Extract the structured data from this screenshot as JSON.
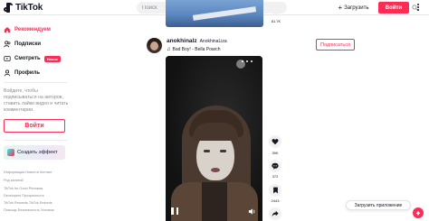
{
  "header": {
    "logo_text": "TikTok",
    "search_placeholder": "Поиск",
    "upload_label": "Загрузить",
    "login_label": "Войти"
  },
  "sidebar": {
    "items": [
      {
        "label": "Рекомендуем",
        "icon": "home-icon",
        "active": true
      },
      {
        "label": "Подписки",
        "icon": "users-icon"
      },
      {
        "label": "Смотреть",
        "icon": "live-icon",
        "badge": "Новое"
      },
      {
        "label": "Профиль",
        "icon": "user-icon"
      }
    ],
    "login_prompt": "Войдите, чтобы подписываться на авторов, ставить лайки видео и читать комментарии.",
    "login_button": "Войти",
    "effect_button": "Создать эффект",
    "footer": {
      "line1": "Информация  Новости  Контакт",
      "line2": "Род занятий",
      "line3": "TikTok for Good  Реклама",
      "line4": "Developers  Прозрачность",
      "line5": "TikTok Rewards  TikTok Embeds",
      "line6": "Помощь  Безопасность  Условия",
      "copyright": "© 2023 TikTok"
    }
  },
  "prev_post": {
    "share_count": "81.7K"
  },
  "post": {
    "username": "anokhinalz",
    "nickname": "AnokhinaLiza",
    "music": "Bad Boy! - Bella Poarch",
    "follow_label": "Подписаться",
    "counts": {
      "likes": "39K",
      "comments": "372",
      "saves": "2443"
    }
  },
  "floating": {
    "get_app": "Загрузить приложение"
  },
  "colors": {
    "accent": "#fe2c55",
    "text": "#161823",
    "muted": "#8a8b91"
  }
}
